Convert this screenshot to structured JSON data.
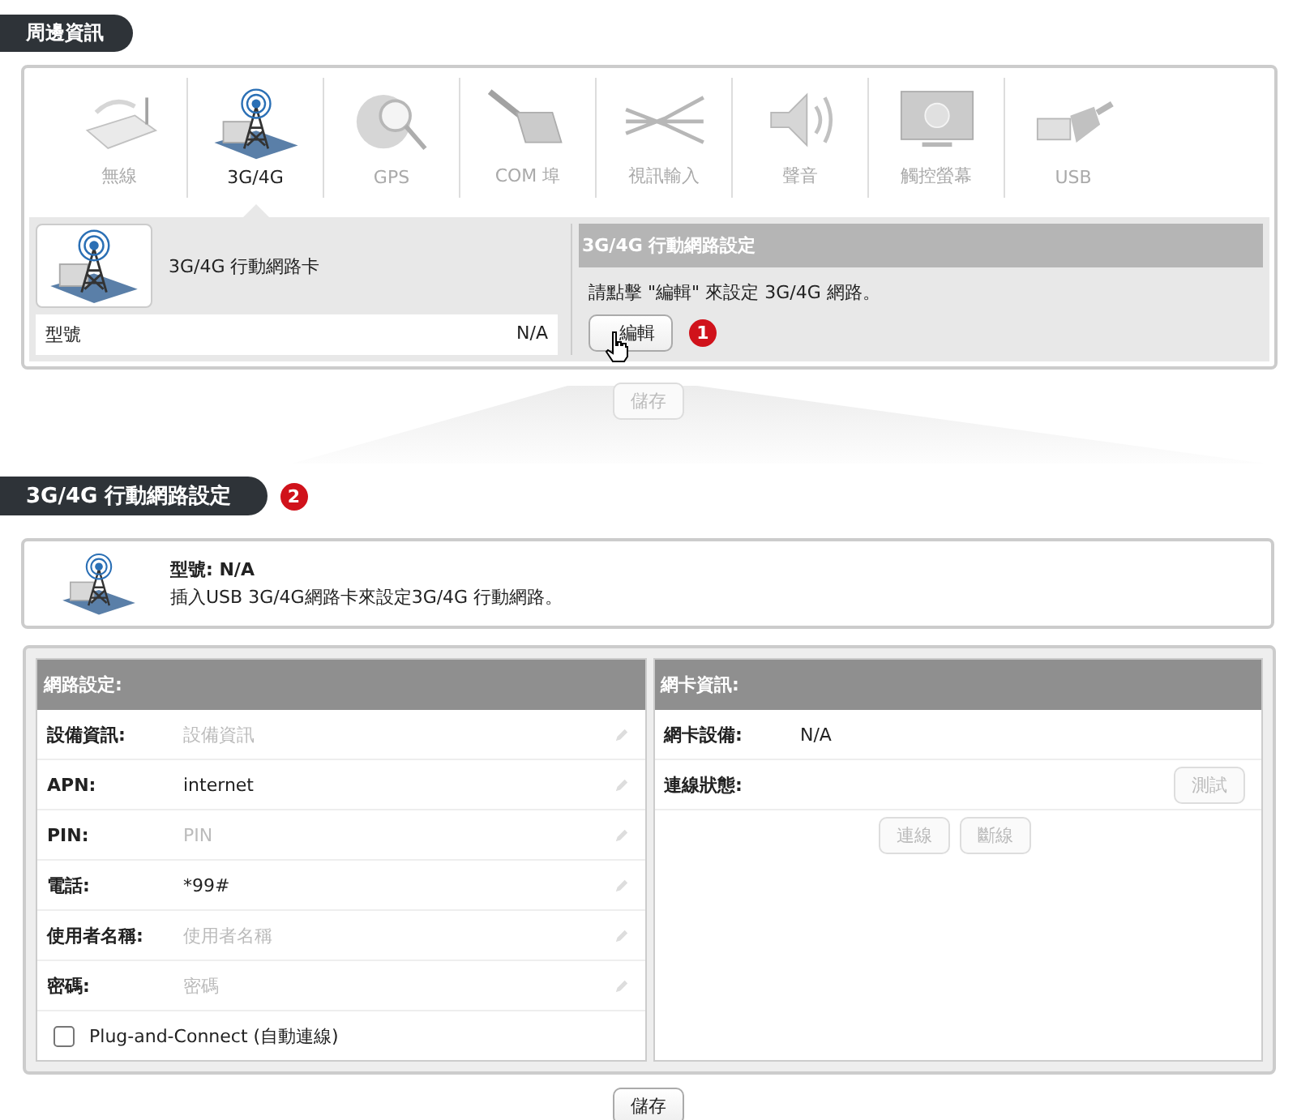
{
  "peripherals": {
    "title": "周邊資訊",
    "tabs": [
      {
        "label": "無線",
        "selected": false
      },
      {
        "label": "3G/4G",
        "selected": true
      },
      {
        "label": "GPS",
        "selected": false
      },
      {
        "label": "COM 埠",
        "selected": false
      },
      {
        "label": "視訊輸入",
        "selected": false
      },
      {
        "label": "聲音",
        "selected": false
      },
      {
        "label": "觸控螢幕",
        "selected": false
      },
      {
        "label": "USB",
        "selected": false
      }
    ],
    "device_card": {
      "name": "3G/4G 行動網路卡",
      "model_label": "型號",
      "model_value": "N/A"
    },
    "settings_panel": {
      "title": "3G/4G 行動網路設定",
      "instruction": "請點擊 \"編輯\" 來設定 3G/4G 網路。",
      "edit_button": "編輯",
      "callout": "1"
    },
    "save_button": {
      "label": "儲存",
      "disabled": true
    }
  },
  "network_settings": {
    "title": "3G/4G 行動網路設定",
    "callout": "2",
    "info": {
      "model": "型號: N/A",
      "description": "插入USB 3G/4G網路卡來設定3G/4G 行動網路。"
    },
    "network_form": {
      "title": "網路設定:",
      "fields": [
        {
          "label": "設備資訊:",
          "placeholder": "設備資訊"
        },
        {
          "label": "APN:",
          "value": "internet"
        },
        {
          "label": "PIN:",
          "placeholder": "PIN"
        },
        {
          "label": "電話:",
          "value": "*99#"
        },
        {
          "label": "使用者名稱:",
          "placeholder": "使用者名稱"
        },
        {
          "label": "密碼:",
          "placeholder": "密碼"
        }
      ],
      "plug_and_connect": {
        "label": "Plug-and-Connect (自動連線)",
        "checked": false
      }
    },
    "card_info": {
      "title": "網卡資訊:",
      "device_label": "網卡設備:",
      "device_value": "N/A",
      "status_label": "連線狀態:",
      "test_button": {
        "label": "測試",
        "disabled": true
      },
      "buttons": [
        {
          "label": "連線",
          "disabled": true
        },
        {
          "label": "斷線",
          "disabled": true
        }
      ]
    },
    "save_button": {
      "label": "儲存",
      "disabled": false
    }
  }
}
